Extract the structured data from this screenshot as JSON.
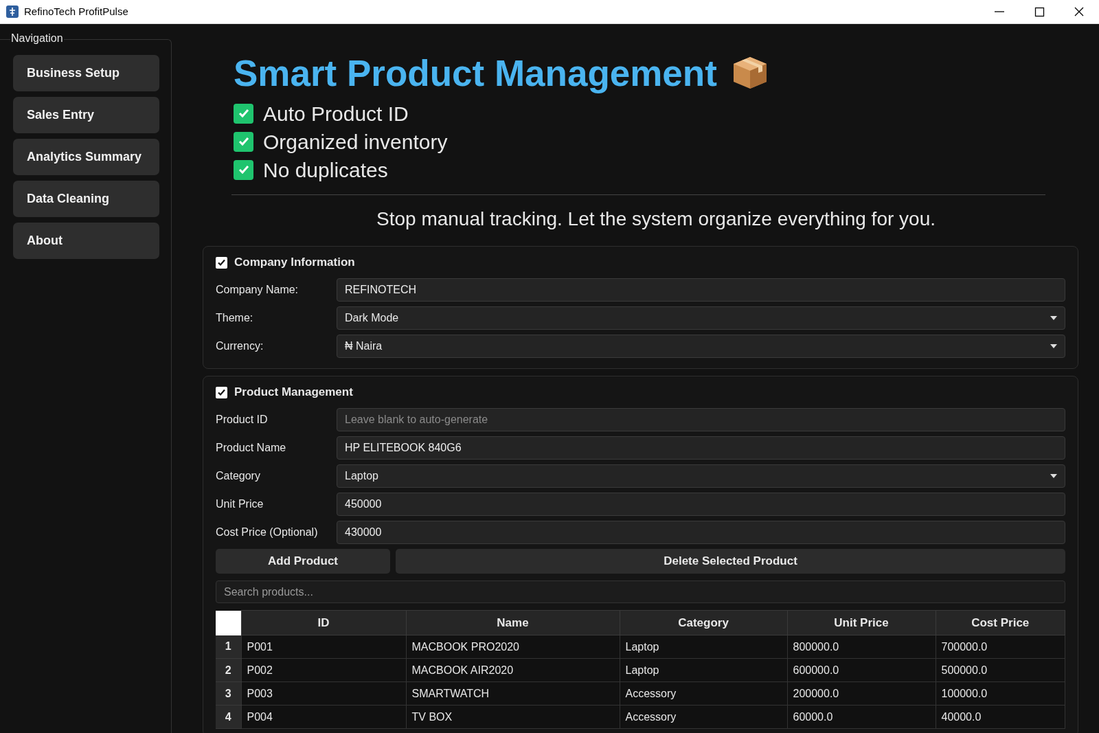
{
  "window": {
    "title": "RefinoTech ProfitPulse"
  },
  "navigation": {
    "title": "Navigation",
    "items": [
      {
        "label": "Business Setup"
      },
      {
        "label": "Sales Entry"
      },
      {
        "label": "Analytics Summary"
      },
      {
        "label": "Data Cleaning"
      },
      {
        "label": "About"
      }
    ]
  },
  "header": {
    "title": "Smart Product Management",
    "features": [
      {
        "label": "Auto Product ID",
        "checked": true
      },
      {
        "label": "Organized inventory",
        "checked": true
      },
      {
        "label": "No duplicates",
        "checked": true
      }
    ],
    "tagline": "Stop manual tracking. Let the system organize everything for you."
  },
  "groups": [
    {
      "title": "Company Information",
      "checked": true,
      "fields": [
        {
          "label": "Company Name:",
          "kind": "text",
          "value": "REFINOTECH"
        },
        {
          "label": "Theme:",
          "kind": "select",
          "value": "Dark Mode"
        },
        {
          "label": "Currency:",
          "kind": "select",
          "value": "₦ Naira"
        }
      ]
    },
    {
      "title": "Product Management",
      "checked": true,
      "fields": [
        {
          "label": "Product ID",
          "kind": "text",
          "placeholder": "Leave blank to auto-generate"
        },
        {
          "label": "Product Name",
          "kind": "text",
          "value": "HP ELITEBOOK 840G6"
        },
        {
          "label": "Category",
          "kind": "select",
          "value": "Laptop"
        },
        {
          "label": "Unit Price",
          "kind": "text",
          "value": "450000"
        },
        {
          "label": "Cost Price (Optional)",
          "kind": "text",
          "value": "430000"
        }
      ],
      "buttons": [
        "Add Product",
        "Delete Selected Product"
      ],
      "search": {
        "placeholder": "Search products..."
      },
      "table": {
        "columns": [
          "ID",
          "Name",
          "Category",
          "Unit Price",
          "Cost Price"
        ],
        "rows": [
          {
            "number": "1",
            "cells": [
              "P001",
              "MACBOOK PRO2020",
              "Laptop",
              "800000.0",
              "700000.0"
            ]
          },
          {
            "number": "2",
            "cells": [
              "P002",
              "MACBOOK AIR2020",
              "Laptop",
              "600000.0",
              "500000.0"
            ]
          },
          {
            "number": "3",
            "cells": [
              "P003",
              "SMARTWATCH",
              "Accessory",
              "200000.0",
              "100000.0"
            ]
          },
          {
            "number": "4",
            "cells": [
              "P004",
              "TV BOX",
              "Accessory",
              "60000.0",
              "40000.0"
            ]
          }
        ]
      }
    }
  ]
}
